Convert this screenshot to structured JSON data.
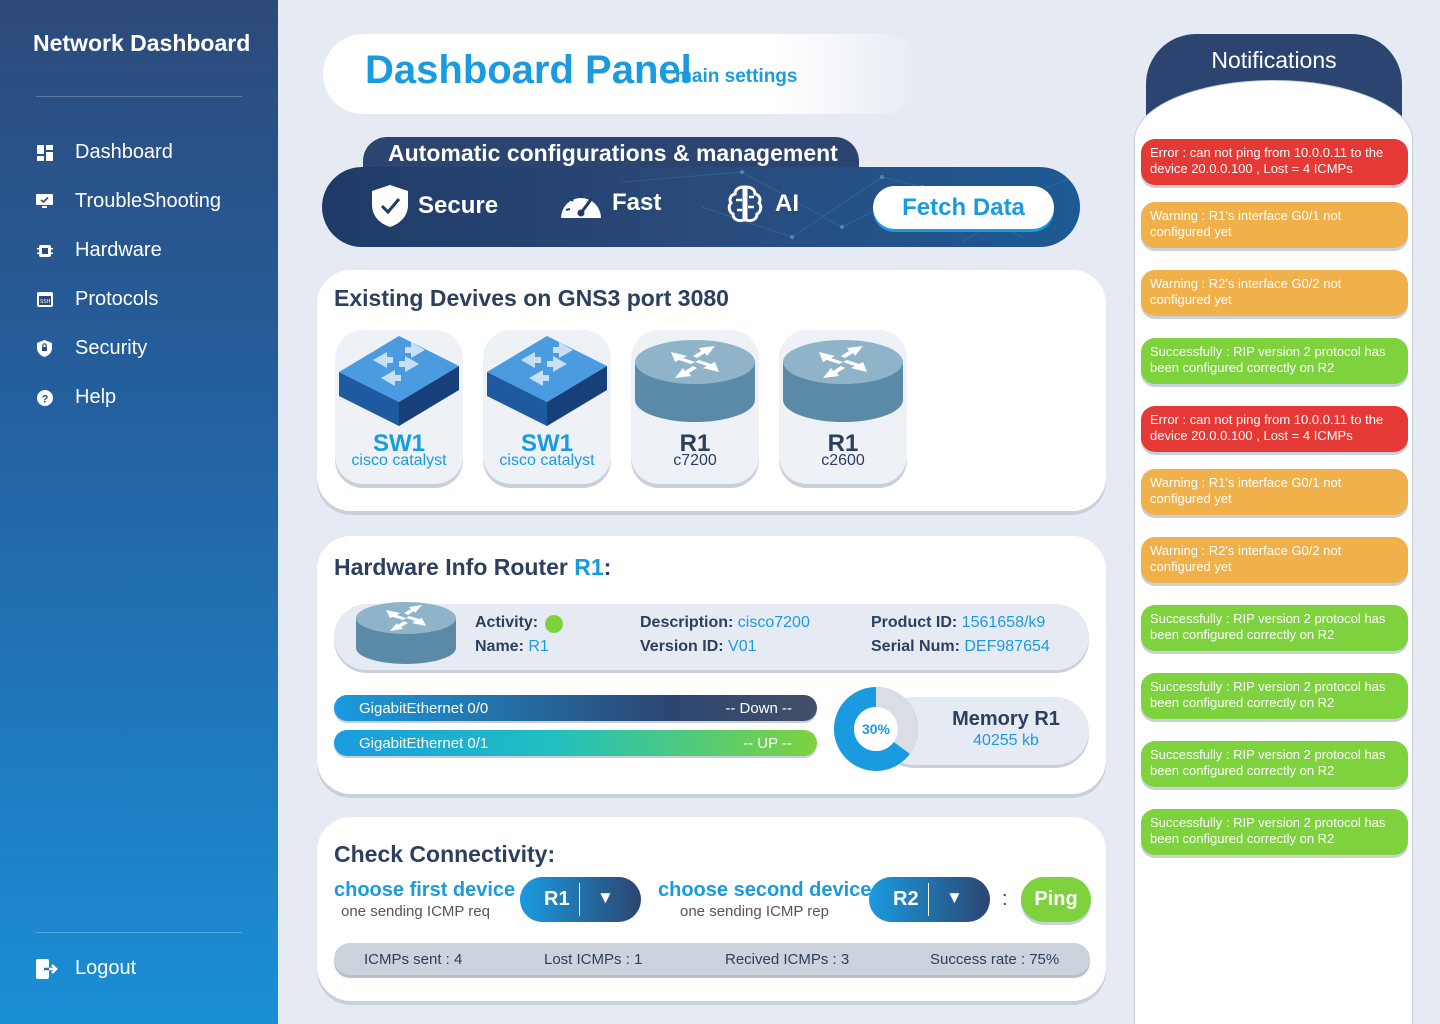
{
  "sidebar": {
    "title": "Network Dashboard",
    "items": [
      {
        "label": "Dashboard",
        "icon": "dashboard-grid-icon"
      },
      {
        "label": "TroubleShooting",
        "icon": "monitor-check-icon"
      },
      {
        "label": "Hardware",
        "icon": "chip-icon"
      },
      {
        "label": "Protocols",
        "icon": "ssh-terminal-icon"
      },
      {
        "label": "Security",
        "icon": "shield-lock-icon"
      },
      {
        "label": "Help",
        "icon": "help-circle-icon"
      }
    ],
    "logout": "Logout"
  },
  "header": {
    "title": "Dashboard Panel",
    "subtitle": "main settings"
  },
  "banner": {
    "tab": "Automatic configurations & management",
    "features": [
      "Secure",
      "Fast",
      "AI"
    ],
    "fetch_button": "Fetch Data"
  },
  "devices": {
    "title": "Existing Devives on GNS3 port 3080",
    "items": [
      {
        "name": "SW1",
        "model": "cisco catalyst",
        "type": "switch"
      },
      {
        "name": "SW1",
        "model": "cisco catalyst",
        "type": "switch"
      },
      {
        "name": "R1",
        "model": "c7200",
        "type": "router"
      },
      {
        "name": "R1",
        "model": "c2600",
        "type": "router"
      }
    ]
  },
  "hardware": {
    "title_prefix": "Hardware Info Router ",
    "title_router": "R1",
    "title_suffix": ":",
    "activity_label": "Activity:",
    "name_label": "Name:",
    "name": "R1",
    "description_label": "Description:",
    "description": "cisco7200",
    "version_label": "Version ID:",
    "version": "V01",
    "product_label": "Product ID:",
    "product": "1561658/k9",
    "serial_label": "Serial Num:",
    "serial": "DEF987654",
    "interfaces": [
      {
        "name": "GigabitEthernet 0/0",
        "status": "-- Down --"
      },
      {
        "name": "GigabitEthernet 0/1",
        "status": "-- UP --"
      }
    ],
    "memory_percent_label": "30%",
    "memory_percent": 30,
    "memory_title": "Memory R1",
    "memory_value": "40255 kb"
  },
  "connectivity": {
    "title": "Check Connectivity:",
    "first_label": "choose first device",
    "first_sub": "one sending ICMP req",
    "first_value": "R1",
    "second_label": "choose second device",
    "second_sub": "one sending ICMP rep",
    "second_value": "R2",
    "separator": ":",
    "ping_button": "Ping",
    "stats": {
      "sent": "ICMPs sent : 4",
      "lost": "Lost ICMPs : 1",
      "received": "Recived ICMPs : 3",
      "rate": "Success rate : 75%"
    }
  },
  "notifications": {
    "title": "Notifications",
    "items": [
      {
        "type": "error",
        "text": "Error : can not ping from 10.0.0.11 to the device 20.0.0.100 , Lost = 4 ICMPs"
      },
      {
        "type": "warning",
        "text": "Warning : R1's interface G0/1 not configured yet"
      },
      {
        "type": "warning",
        "text": "Warning : R2's interface G0/2 not configured yet"
      },
      {
        "type": "success",
        "text": "Successfully : RIP version 2 protocol has been configured correctly on R2"
      },
      {
        "type": "error",
        "text": "Error : can not ping from 10.0.0.11 to the device 20.0.0.100 , Lost = 4 ICMPs"
      },
      {
        "type": "warning",
        "text": "Warning : R1's interface G0/1 not configured yet"
      },
      {
        "type": "warning",
        "text": "Warning : R2's interface G0/2 not configured yet"
      },
      {
        "type": "success",
        "text": "Successfully : RIP version 2 protocol has been configured correctly on R2"
      },
      {
        "type": "success",
        "text": "Successfully : RIP version 2 protocol has been configured correctly on R2"
      },
      {
        "type": "success",
        "text": "Successfully : RIP version 2 protocol has been configured correctly on R2"
      },
      {
        "type": "success",
        "text": "Successfully : RIP version 2 protocol has been configured correctly on R2"
      }
    ]
  },
  "colors": {
    "accent": "#1a9be0",
    "navy": "#2c4570",
    "error": "#e53935",
    "warning": "#f0b04a",
    "success": "#7ed23d"
  }
}
